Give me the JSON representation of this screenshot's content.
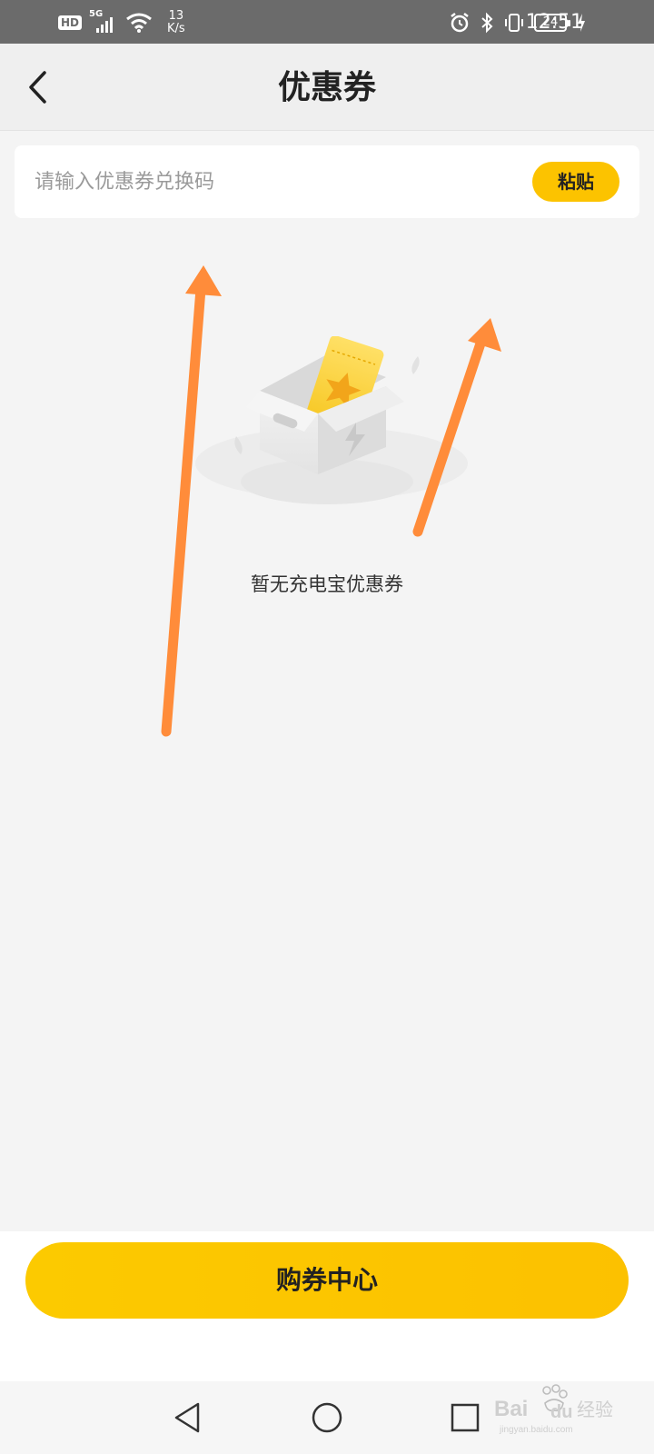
{
  "status_bar": {
    "hd": "HD",
    "network": "5G",
    "speed_value": "13",
    "speed_unit": "K/s",
    "battery": "24",
    "time": "12:51"
  },
  "header": {
    "title": "优惠券",
    "back_icon": "chevron-left-icon"
  },
  "coupon_code": {
    "placeholder": "请输入优惠券兑换码",
    "value": "",
    "paste_label": "粘贴"
  },
  "empty_state": {
    "message": "暂无充电宝优惠券",
    "illustration": "empty-box-ticket-icon"
  },
  "bottom": {
    "buy_label": "购券中心"
  },
  "colors": {
    "accent": "#fcc300",
    "page_bg": "#f4f4f4",
    "annotation_arrow": "#ff8c3a"
  },
  "watermark": {
    "logo": "baidu-jingyan-logo",
    "text": "jingyan.baidu.com"
  }
}
